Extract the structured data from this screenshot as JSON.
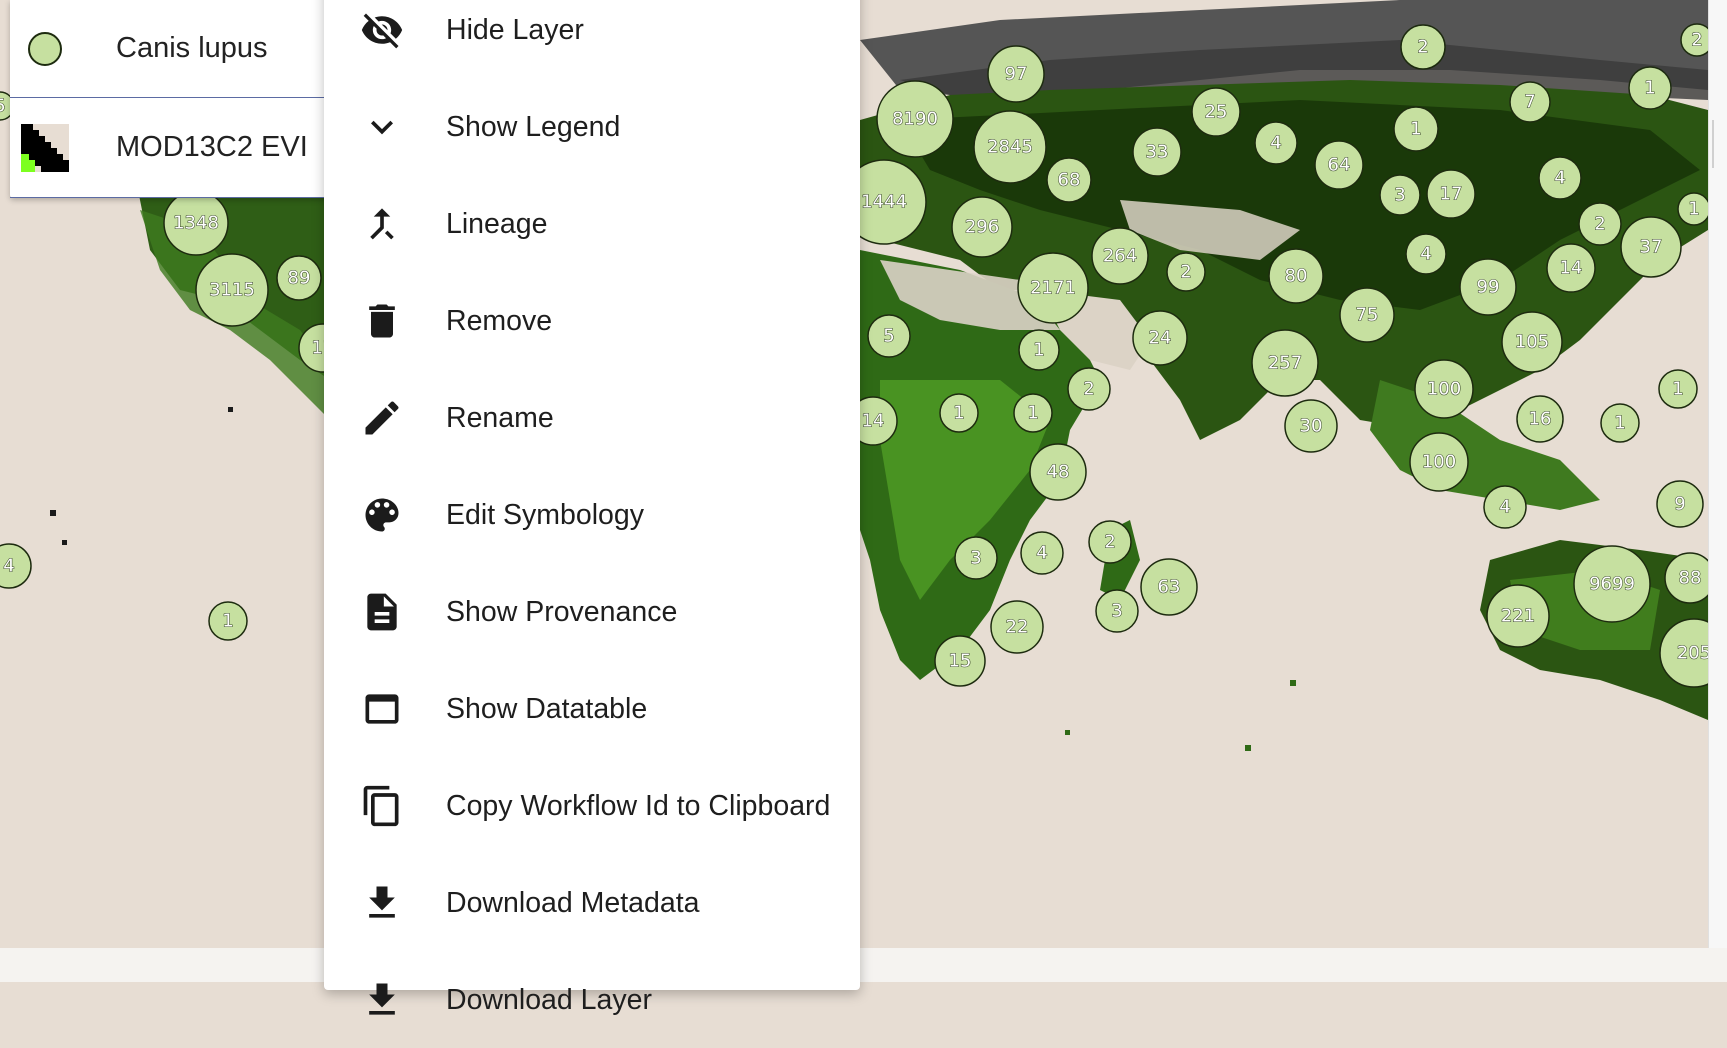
{
  "layers": [
    {
      "name": "Canis lupus",
      "symbol": "circle-point-symbol",
      "fill": "#c6e0a0"
    },
    {
      "name": "MOD13C2 EVI",
      "symbol": "raster-colormap-symbol"
    }
  ],
  "context_menu": {
    "items": [
      {
        "label": "Hide Layer",
        "icon": "visibility-off-icon"
      },
      {
        "label": "Show Legend",
        "icon": "chevron-down-icon"
      },
      {
        "label": "Lineage",
        "icon": "merge-icon"
      },
      {
        "label": "Remove",
        "icon": "trash-icon"
      },
      {
        "label": "Rename",
        "icon": "pencil-icon"
      },
      {
        "label": "Edit Symbology",
        "icon": "palette-icon"
      },
      {
        "label": "Show Provenance",
        "icon": "document-icon"
      },
      {
        "label": "Show Datatable",
        "icon": "table-window-icon"
      },
      {
        "label": "Copy Workflow Id to Clipboard",
        "icon": "copy-icon"
      },
      {
        "label": "Download Metadata",
        "icon": "download-icon"
      },
      {
        "label": "Download Layer",
        "icon": "download-icon"
      }
    ]
  },
  "map": {
    "cluster_color": "#c6e0a0",
    "clusters": [
      "5",
      "1348",
      "3115",
      "89",
      "17",
      "1",
      "4",
      "8190",
      "97",
      "2845",
      "68",
      "33",
      "25",
      "4",
      "64",
      "2",
      "7",
      "1",
      "1",
      "2",
      "1444",
      "296",
      "264",
      "2",
      "2171",
      "3",
      "17",
      "4",
      "2",
      "37",
      "1",
      "80",
      "4",
      "99",
      "14",
      "5",
      "1",
      "24",
      "257",
      "75",
      "105",
      "14",
      "1",
      "2",
      "1",
      "100",
      "16",
      "1",
      "30",
      "1",
      "48",
      "100",
      "4",
      "9",
      "2",
      "3",
      "4",
      "63",
      "3",
      "22",
      "9699",
      "88",
      "221",
      "15",
      "205"
    ]
  }
}
